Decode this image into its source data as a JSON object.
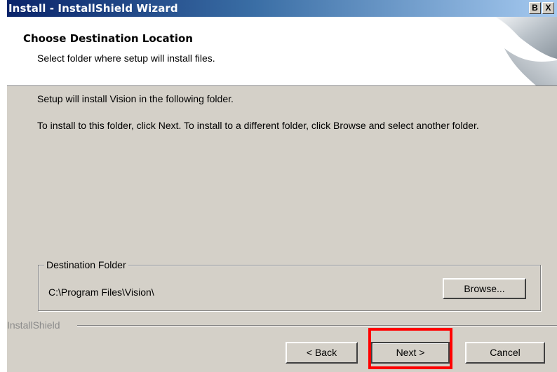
{
  "window": {
    "title": "Install - InstallShield Wizard",
    "restore_glyph": "B",
    "close_glyph": "X"
  },
  "header": {
    "title": "Choose Destination Location",
    "subtitle": "Select folder where setup will install files."
  },
  "body": {
    "line1": "Setup will install Vision in the following folder.",
    "line2": "To install to this folder, click Next. To install to a different folder, click Browse and select another folder."
  },
  "destination": {
    "legend": "Destination Folder",
    "path": "C:\\Program Files\\Vision\\",
    "browse_label": "Browse..."
  },
  "footer": {
    "brand": "InstallShield",
    "back_label": "< Back",
    "next_label": "Next >",
    "cancel_label": "Cancel"
  },
  "annotation": {
    "color": "#ff0000"
  }
}
